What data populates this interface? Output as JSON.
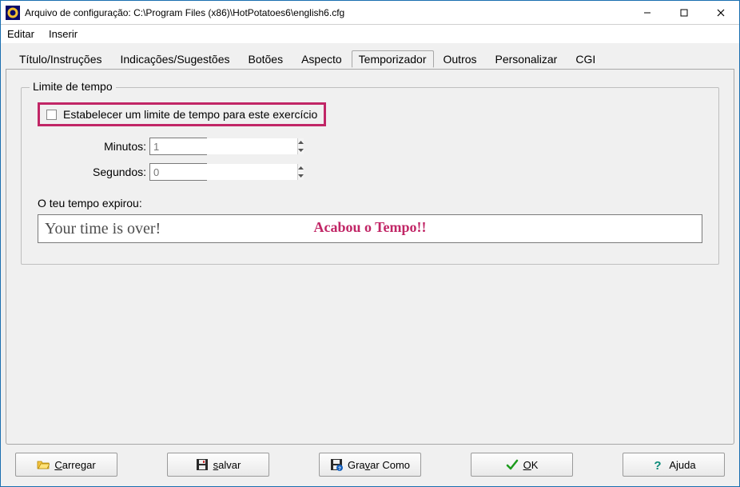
{
  "window": {
    "title": "Arquivo de configuração: C:\\Program Files (x86)\\HotPotatoes6\\english6.cfg"
  },
  "menubar": {
    "items": [
      "Editar",
      "Inserir"
    ]
  },
  "tabs": {
    "items": [
      "Título/Instruções",
      "Indicações/Sugestões",
      "Botões",
      "Aspecto",
      "Temporizador",
      "Outros",
      "Personalizar",
      "CGI"
    ],
    "selected_index": 4
  },
  "group": {
    "legend": "Limite de tempo",
    "checkbox_label": "Estabelecer um limite de tempo para este exercício",
    "minutes_label": "Minutos:",
    "minutes_value": "1",
    "seconds_label": "Segundos:",
    "seconds_value": "0",
    "expired_label": "O teu tempo expirou:",
    "expired_value": "Your time is over!",
    "annotation": "Acabou o Tempo!!"
  },
  "buttons": {
    "load": {
      "prefix": "",
      "u": "C",
      "suffix": "arregar"
    },
    "save": {
      "prefix": "",
      "u": "s",
      "suffix": "alvar"
    },
    "saveas": {
      "prefix": "Gra",
      "u": "v",
      "suffix": "ar Como"
    },
    "ok": {
      "prefix": "",
      "u": "O",
      "suffix": "K"
    },
    "help": {
      "prefix": "A",
      "u": "j",
      "suffix": "uda"
    }
  },
  "colors": {
    "highlight": "#c12666"
  }
}
